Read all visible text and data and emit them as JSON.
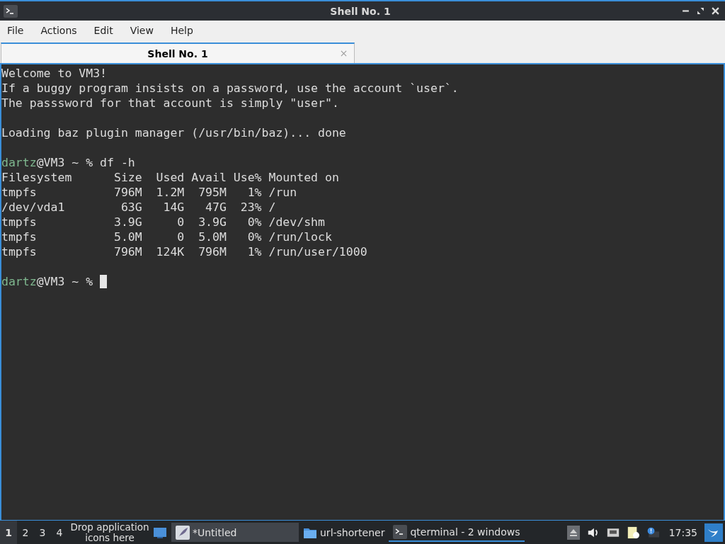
{
  "window": {
    "title": "Shell No. 1"
  },
  "menu": [
    "File",
    "Actions",
    "Edit",
    "View",
    "Help"
  ],
  "tabs": [
    {
      "label": "Shell No. 1",
      "selected": true
    }
  ],
  "terminal": {
    "lines": [
      {
        "kind": "text",
        "text": "Welcome to VM3!"
      },
      {
        "kind": "text",
        "text": "If a buggy program insists on a password, use the account `user`."
      },
      {
        "kind": "text",
        "text": "The passsword for that account is simply \"user\"."
      },
      {
        "kind": "blank"
      },
      {
        "kind": "text",
        "text": "Loading baz plugin manager (/usr/bin/baz)... done"
      },
      {
        "kind": "blank"
      },
      {
        "kind": "prompt",
        "user": "dartz",
        "rest": "@VM3 ~ % df -h",
        "cursor": false
      },
      {
        "kind": "text",
        "text": "Filesystem      Size  Used Avail Use% Mounted on"
      },
      {
        "kind": "text",
        "text": "tmpfs           796M  1.2M  795M   1% /run"
      },
      {
        "kind": "text",
        "text": "/dev/vda1        63G   14G   47G  23% /"
      },
      {
        "kind": "text",
        "text": "tmpfs           3.9G     0  3.9G   0% /dev/shm"
      },
      {
        "kind": "text",
        "text": "tmpfs           5.0M     0  5.0M   0% /run/lock"
      },
      {
        "kind": "text",
        "text": "tmpfs           796M  124K  796M   1% /run/user/1000"
      },
      {
        "kind": "blank"
      },
      {
        "kind": "prompt",
        "user": "dartz",
        "rest": "@VM3 ~ %",
        "cursor": true
      }
    ]
  },
  "taskbar": {
    "desktops": [
      {
        "label": "1",
        "selected": true
      },
      {
        "label": "2",
        "selected": false
      },
      {
        "label": "3",
        "selected": false
      },
      {
        "label": "4",
        "selected": false
      }
    ],
    "quicklaunch_hint": "Drop application icons here",
    "tasks": [
      {
        "label": "*Untitled",
        "kind": "editor",
        "highlighted": true,
        "selected": false
      },
      {
        "label": "url-shortener",
        "kind": "folder",
        "highlighted": false,
        "selected": false
      },
      {
        "label": "qterminal - 2 windows",
        "kind": "terminal",
        "highlighted": false,
        "selected": true
      }
    ],
    "clock": "17:35"
  }
}
